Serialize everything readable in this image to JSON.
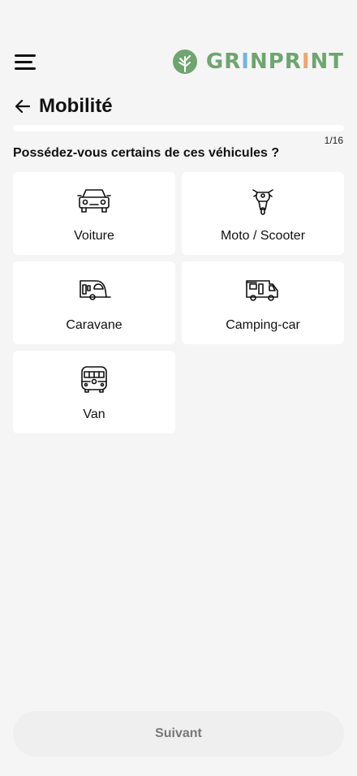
{
  "header": {
    "logo": {
      "text_parts": [
        "GR",
        "I",
        "N",
        "PR",
        "I",
        "NT"
      ],
      "colors": [
        "#6fa56f",
        "#6fb6d8",
        "#6fa56f",
        "#6fa56f",
        "#f2a56a",
        "#6fa56f"
      ]
    },
    "menu_icon": "hamburger-icon"
  },
  "page": {
    "back_icon": "arrow-left-icon",
    "title": "Mobilité",
    "progress": {
      "current": 1,
      "total": 16,
      "label": "1/16"
    },
    "question": "Possédez-vous certains de ces véhicules ?"
  },
  "options": [
    {
      "label": "Voiture",
      "icon": "car-icon"
    },
    {
      "label": "Moto / Scooter",
      "icon": "motorcycle-icon"
    },
    {
      "label": "Caravane",
      "icon": "caravan-icon"
    },
    {
      "label": "Camping-car",
      "icon": "camper-icon"
    },
    {
      "label": "Van",
      "icon": "van-icon"
    }
  ],
  "footer": {
    "next_label": "Suivant"
  },
  "colors": {
    "brand_green": "#6fa56f",
    "brand_blue": "#6fb6d8",
    "brand_orange": "#f2a56a",
    "background": "#f5f5f5"
  }
}
